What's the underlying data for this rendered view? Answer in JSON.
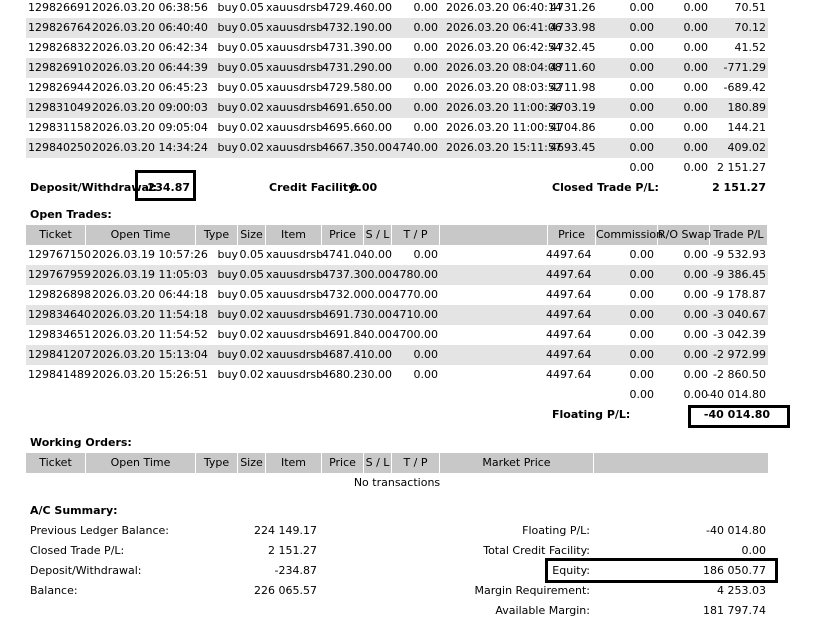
{
  "closed_rows": [
    [
      "129826691",
      "2026.03.20 06:38:56",
      "buy",
      "0.05",
      "xauusdrsb",
      "4729.46",
      "0.00",
      "0.00",
      "2026.03.20 06:40:14",
      "4731.26",
      "0.00",
      "0.00",
      "70.51"
    ],
    [
      "129826764",
      "2026.03.20 06:40:40",
      "buy",
      "0.05",
      "xauusdrsb",
      "4732.19",
      "0.00",
      "0.00",
      "2026.03.20 06:41:06",
      "4733.98",
      "0.00",
      "0.00",
      "70.12"
    ],
    [
      "129826832",
      "2026.03.20 06:42:34",
      "buy",
      "0.05",
      "xauusdrsb",
      "4731.39",
      "0.00",
      "0.00",
      "2026.03.20 06:42:54",
      "4732.45",
      "0.00",
      "0.00",
      "41.52"
    ],
    [
      "129826910",
      "2026.03.20 06:44:39",
      "buy",
      "0.05",
      "xauusdrsb",
      "4731.29",
      "0.00",
      "0.00",
      "2026.03.20 08:04:08",
      "4711.60",
      "0.00",
      "0.00",
      "-771.29"
    ],
    [
      "129826944",
      "2026.03.20 06:45:23",
      "buy",
      "0.05",
      "xauusdrsb",
      "4729.58",
      "0.00",
      "0.00",
      "2026.03.20 08:03:52",
      "4711.98",
      "0.00",
      "0.00",
      "-689.42"
    ],
    [
      "129831049",
      "2026.03.20 09:00:03",
      "buy",
      "0.02",
      "xauusdrsb",
      "4691.65",
      "0.00",
      "0.00",
      "2026.03.20 11:00:36",
      "4703.19",
      "0.00",
      "0.00",
      "180.89"
    ],
    [
      "129831158",
      "2026.03.20 09:05:04",
      "buy",
      "0.02",
      "xauusdrsb",
      "4695.66",
      "0.00",
      "0.00",
      "2026.03.20 11:00:51",
      "4704.86",
      "0.00",
      "0.00",
      "144.21"
    ],
    [
      "129840250",
      "2026.03.20 14:34:24",
      "buy",
      "0.02",
      "xauusdrsb",
      "4667.35",
      "0.00",
      "4740.00",
      "2026.03.20 15:11:57",
      "4693.45",
      "0.00",
      "0.00",
      "409.02"
    ]
  ],
  "closed_totals": {
    "commission": "0.00",
    "swap": "0.00",
    "pl": "2 151.27"
  },
  "closed_summary": {
    "deposit_label": "Deposit/Withdrawal:",
    "deposit_value": "-234.87",
    "credit_label": "Credit Facility:",
    "credit_value": "0.00",
    "closed_pl_label": "Closed Trade P/L:",
    "closed_pl_value": "2 151.27"
  },
  "open_trades": {
    "title": "Open Trades:",
    "headers": [
      "Ticket",
      "Open Time",
      "Type",
      "Size",
      "Item",
      "Price",
      "S / L",
      "T / P",
      "Price",
      "Commission",
      "R/O Swap",
      "Trade P/L"
    ],
    "rows": [
      [
        "129767150",
        "2026.03.19 10:57:26",
        "buy",
        "0.05",
        "xauusdrsb",
        "4741.04",
        "0.00",
        "0.00",
        "4497.64",
        "0.00",
        "0.00",
        "-9 532.93"
      ],
      [
        "129767959",
        "2026.03.19 11:05:03",
        "buy",
        "0.05",
        "xauusdrsb",
        "4737.30",
        "0.00",
        "4780.00",
        "4497.64",
        "0.00",
        "0.00",
        "-9 386.45"
      ],
      [
        "129826898",
        "2026.03.20 06:44:18",
        "buy",
        "0.05",
        "xauusdrsb",
        "4732.00",
        "0.00",
        "4770.00",
        "4497.64",
        "0.00",
        "0.00",
        "-9 178.87"
      ],
      [
        "129834640",
        "2026.03.20 11:54:18",
        "buy",
        "0.02",
        "xauusdrsb",
        "4691.73",
        "0.00",
        "4710.00",
        "4497.64",
        "0.00",
        "0.00",
        "-3 040.67"
      ],
      [
        "129834651",
        "2026.03.20 11:54:52",
        "buy",
        "0.02",
        "xauusdrsb",
        "4691.84",
        "0.00",
        "4700.00",
        "4497.64",
        "0.00",
        "0.00",
        "-3 042.39"
      ],
      [
        "129841207",
        "2026.03.20 15:13:04",
        "buy",
        "0.02",
        "xauusdrsb",
        "4687.41",
        "0.00",
        "0.00",
        "4497.64",
        "0.00",
        "0.00",
        "-2 972.99"
      ],
      [
        "129841489",
        "2026.03.20 15:26:51",
        "buy",
        "0.02",
        "xauusdrsb",
        "4680.23",
        "0.00",
        "0.00",
        "4497.64",
        "0.00",
        "0.00",
        "-2 860.50"
      ]
    ],
    "totals": {
      "commission": "0.00",
      "swap": "0.00",
      "pl": "-40 014.80"
    },
    "floating_label": "Floating P/L:",
    "floating_value": "-40 014.80"
  },
  "working_orders": {
    "title": "Working Orders:",
    "headers": [
      "Ticket",
      "Open Time",
      "Type",
      "Size",
      "Item",
      "Price",
      "S / L",
      "T / P",
      "Market Price"
    ],
    "empty": "No transactions"
  },
  "summary": {
    "title": "A/C Summary:",
    "prev_label": "Previous Ledger Balance:",
    "prev_value": "224 149.17",
    "closed_label": "Closed Trade P/L:",
    "closed_value": "2 151.27",
    "deposit_label": "Deposit/Withdrawal:",
    "deposit_value": "-234.87",
    "balance_label": "Balance:",
    "balance_value": "226 065.57",
    "floating_label": "Floating P/L:",
    "floating_value": "-40 014.80",
    "credit_label": "Total Credit Facility:",
    "credit_value": "0.00",
    "equity_label": "Equity:",
    "equity_value": "186 050.77",
    "margin_label": "Margin Requirement:",
    "margin_value": "4 253.03",
    "available_label": "Available Margin:",
    "available_value": "181 797.74"
  },
  "colors": {
    "row_alt": "#e4e4e4",
    "header": "#c8c8c8",
    "highlight_box": "#000000"
  }
}
